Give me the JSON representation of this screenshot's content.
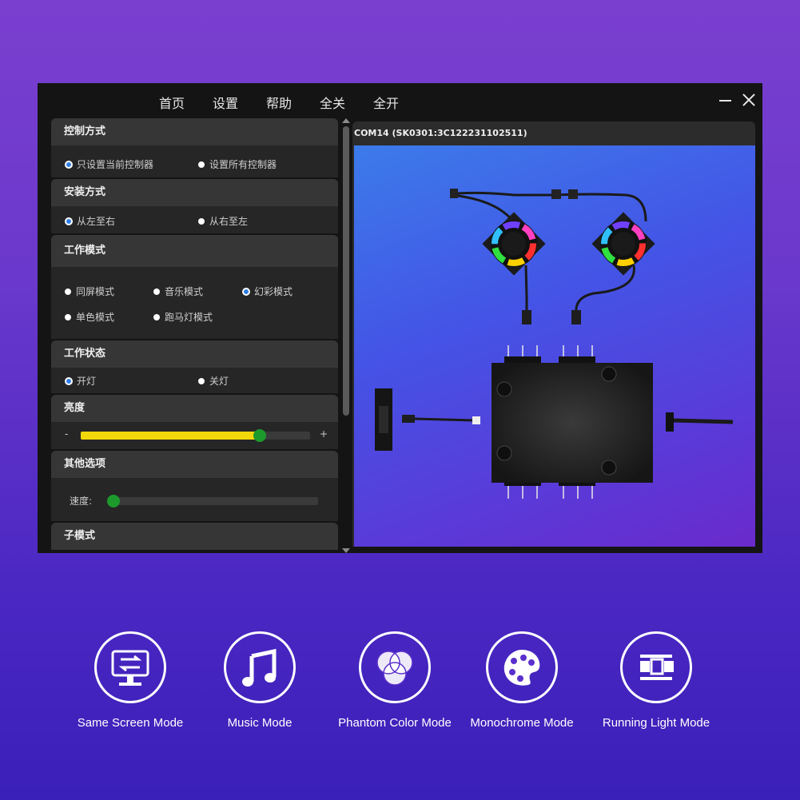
{
  "menu": {
    "home": "首页",
    "settings": "设置",
    "help": "帮助",
    "all_off": "全关",
    "all_on": "全开"
  },
  "control_method": {
    "title": "控制方式",
    "options": [
      "只设置当前控制器",
      "设置所有控制器"
    ],
    "selected": 0
  },
  "install_method": {
    "title": "安装方式",
    "options": [
      "从左至右",
      "从右至左"
    ],
    "selected": 0
  },
  "work_mode": {
    "title": "工作模式",
    "options": [
      "同屏模式",
      "音乐模式",
      "幻彩模式",
      "单色模式",
      "跑马灯模式"
    ],
    "selected": 2
  },
  "work_state": {
    "title": "工作状态",
    "options": [
      "开灯",
      "关灯"
    ],
    "selected": 0
  },
  "brightness": {
    "title": "亮度",
    "minus": "-",
    "plus": "+",
    "value_fraction": 0.78,
    "fill_color": "#f2d80a",
    "knob_color": "#1c9a2c"
  },
  "other_options": {
    "title": "其他选项",
    "speed_label": "速度:",
    "speed_fraction": 0.0
  },
  "sub_mode": {
    "title": "子模式"
  },
  "device": {
    "title": "COM14 (SK0301:3C122231102511)"
  },
  "features": [
    {
      "label": "Same Screen Mode",
      "icon": "monitor-sync-icon"
    },
    {
      "label": "Music Mode",
      "icon": "music-note-icon"
    },
    {
      "label": "Phantom Color Mode",
      "icon": "color-circles-icon"
    },
    {
      "label": "Monochrome Mode",
      "icon": "palette-icon"
    },
    {
      "label": "Running Light Mode",
      "icon": "running-light-icon"
    }
  ],
  "colors": {
    "accent_radio": "#2f7ee6",
    "panel_bg": "#262626",
    "header_bg": "#363636"
  }
}
